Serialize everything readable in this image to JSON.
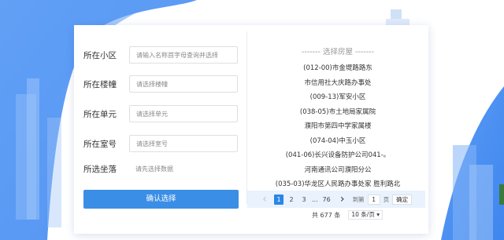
{
  "form": {
    "community_label": "所在小区",
    "community_placeholder": "请输入名称首字母查询并选择",
    "building_label": "所在楼幢",
    "building_placeholder": "请选择楼幢",
    "unit_label": "所在单元",
    "unit_placeholder": "请选择单元",
    "room_label": "所在室号",
    "room_placeholder": "请选择室号",
    "location_label": "所选坐落",
    "location_value": "请先选择数据",
    "confirm_label": "确认选择"
  },
  "house_panel": {
    "title": "------- 选择房屋 -------",
    "items": [
      "(012-00)市金堤路路东",
      "市信用社大庆路办事处",
      "(009-13)军安小区",
      "(038-05)市土地局家属院",
      "濮阳市第四中学家属楼",
      "(074-04)中玉小区",
      "(041-06)长兴设备防护公司041-。",
      "河南通讯公司濮阳分公",
      "(035-03)华龙区人民路办事处家 胜利路北"
    ]
  },
  "pagination": {
    "prev_icon": "‹",
    "pages": [
      "1",
      "2",
      "3"
    ],
    "ellipsis": "...",
    "last_page": "76",
    "next_icon": "›",
    "goto_label": "到第",
    "goto_value": "1",
    "page_label": "页",
    "ok_label": "确定",
    "total_label": "共 677 条",
    "page_size": "10 条/页 ▾"
  }
}
